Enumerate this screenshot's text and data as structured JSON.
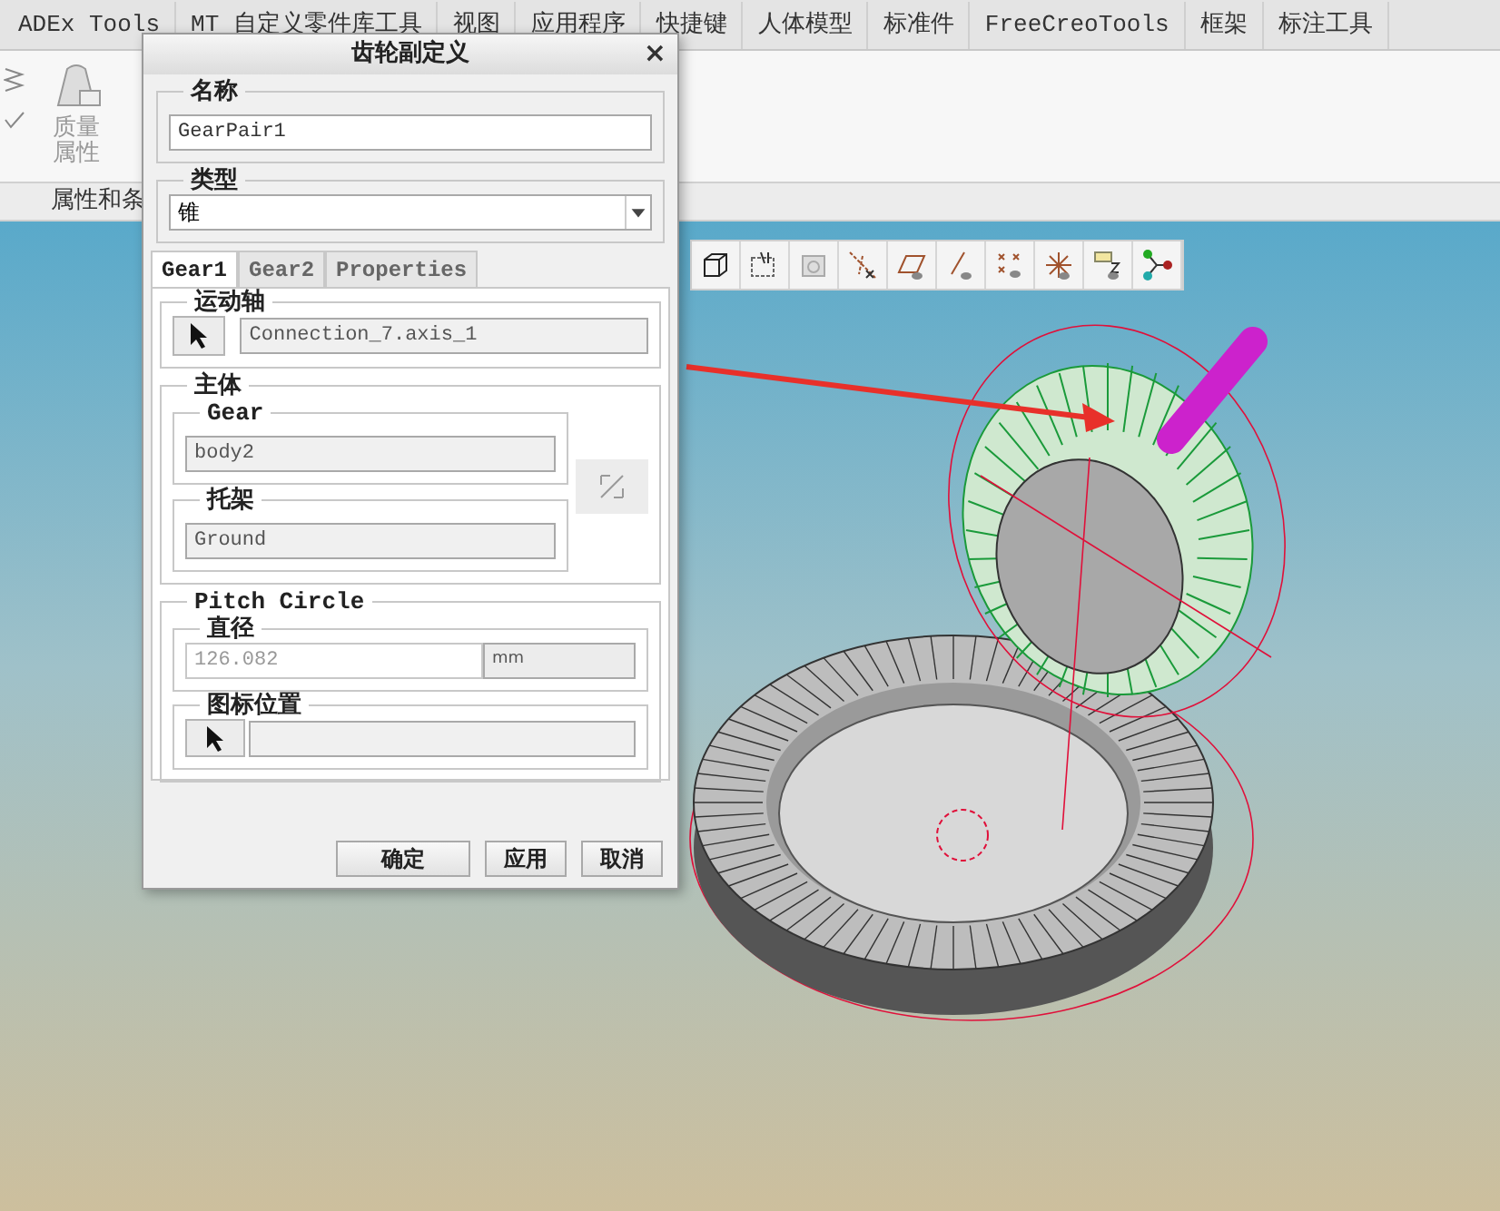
{
  "ribbon_tabs": [
    "ADEx Tools",
    "MT 自定义零件库工具",
    "视图",
    "应用程序",
    "快捷键",
    "人体模型",
    "标准件",
    "FreeCreoTools",
    "框架",
    "标注工具"
  ],
  "ribbon": {
    "button": {
      "label": "质量属性",
      "disabled": true
    },
    "group_label": "属性和条"
  },
  "dialog": {
    "title": "齿轮副定义",
    "close": "×",
    "name": {
      "label": "名称",
      "value": "GearPair1"
    },
    "type": {
      "label": "类型",
      "value": "锥"
    },
    "tabs": [
      {
        "label": "Gear1",
        "selected": true
      },
      {
        "label": "Gear2",
        "selected": false
      },
      {
        "label": "Properties",
        "selected": false
      }
    ],
    "motion_axis": {
      "label": "运动轴",
      "value": "Connection_7.axis_1"
    },
    "body": {
      "label": "主体",
      "gear": {
        "label": "Gear",
        "value": "body2"
      },
      "carrier": {
        "label": "托架",
        "value": "Ground"
      }
    },
    "pitch_circle": {
      "label": "Pitch Circle",
      "diameter": {
        "label": "直径",
        "value": "126.082",
        "unit": "mm"
      },
      "icon_position": {
        "label": "图标位置"
      }
    },
    "buttons": [
      "确定",
      "应用",
      "取消"
    ]
  }
}
